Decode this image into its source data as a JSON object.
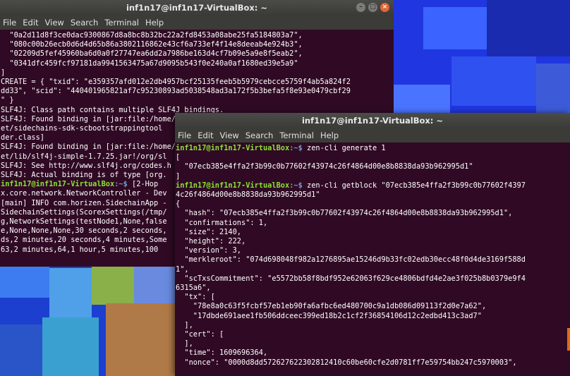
{
  "menu": [
    "File",
    "Edit",
    "View",
    "Search",
    "Terminal",
    "Help"
  ],
  "back_terminal": {
    "title": "inf1n17@inf1n17-VirtualBox: ~",
    "lines": [
      {
        "t": "  \"0a2d11d8f3ce0dac9300867d8a8bc8b32bc22a2fd8453a08abe25fa5184803a7\","
      },
      {
        "t": "  \"080c00b26ecb0d6d4d65b86a3802116862e43cf6a733ef4f14e8deeab4e924b3\","
      },
      {
        "t": "  \"02209d5fef45960ba6d0a0f27747ea6dd2a7986be163d4cf7b09e5a9e8f5eab2\","
      },
      {
        "t": "  \"0341dfc459fcf97181da9941563475a67d9095b543f0e240a0af1680ed39e5a9\""
      },
      {
        "t": "]"
      },
      {
        "t": "CREATE = { \"txid\": \"e359357afd012e2db4957bcf25135feeb5b5979cebcce5759f4ab5a824f2"
      },
      {
        "t": "dd33\", \"scid\": \"440401965821af7c95230893ad5038548ad3a172f5b3befa5f8e93e0479cbf29"
      },
      {
        "t": "\" }"
      },
      {
        "t": "SLF4J: Class path contains multiple SLF4J bindings."
      },
      {
        "t": "SLF4J: Found binding in [jar:file:/home/"
      },
      {
        "t": "et/sidechains-sdk-scbootstrappingtool"
      },
      {
        "t": "der.class]"
      },
      {
        "t": "SLF4J: Found binding in [jar:file:/home/"
      },
      {
        "t": "et/lib/slf4j-simple-1.7.25.jar!/org/sl"
      },
      {
        "t": "SLF4J: See http://www.slf4j.org/codes.h"
      },
      {
        "t": "SLF4J: Actual binding is of type [org."
      },
      {
        "u": "inf1n17@inf1n17-VirtualBox",
        "p": ":~$",
        "t": " [2-Hop"
      },
      {
        "t": "x.core.network.NetworkController - Dev"
      },
      {
        "t": "[main] INFO com.horizen.SidechainApp -"
      },
      {
        "t": "SidechainSettings(ScorexSettings(/tmp/"
      },
      {
        "t": "g,NetworkSettings(testNode1,None,false"
      },
      {
        "t": "e,None,None,None,30 seconds,2 seconds,"
      },
      {
        "t": "ds,2 minutes,20 seconds,4 minutes,Some"
      },
      {
        "t": "63,2 minutes,64,1 hour,5 minutes,100"
      }
    ]
  },
  "front_terminal": {
    "title": "inf1n17@inf1n17-VirtualBox: ~",
    "lines": [
      {
        "u": "inf1n17@inf1n17-VirtualBox",
        "p": ":~$",
        "t": " zen-cli generate 1"
      },
      {
        "t": "["
      },
      {
        "t": "  \"07ecb385e4ffa2f3b99c0b77602f43974c26f4864d00e8b8838da93b962995d1\""
      },
      {
        "t": "]"
      },
      {
        "u": "inf1n17@inf1n17-VirtualBox",
        "p": ":~$",
        "t": " zen-cli getblock \"07ecb385e4ffa2f3b99c0b77602f4397"
      },
      {
        "t": "4c26f4864d00e8b8838da93b962995d1\""
      },
      {
        "t": "{"
      },
      {
        "t": "  \"hash\": \"07ecb385e4ffa2f3b99c0b77602f43974c26f4864d00e8b8838da93b962995d1\","
      },
      {
        "t": "  \"confirmations\": 1,"
      },
      {
        "t": "  \"size\": 2140,"
      },
      {
        "t": "  \"height\": 222,"
      },
      {
        "t": "  \"version\": 3,"
      },
      {
        "t": "  \"merkleroot\": \"074d698048f982a1276895ae15246d9b33fc02edb30ecc48f0d4de3169f588d"
      },
      {
        "t": "1\","
      },
      {
        "t": "  \"scTxsCommitment\": \"e5572bb58f8bdf952e62063f629ce4806bdfd4e2ae3f025b8b0379e9f4"
      },
      {
        "t": "6315a6\","
      },
      {
        "t": "  \"tx\": ["
      },
      {
        "t": "    \"78e8a0c63f5fcbf57eb1eb90fa6afbc6ed480700c9a1db086d09113f2d0e7a62\","
      },
      {
        "t": "    \"17dbde691aee1fb506ddceec399ed18b2c1cf2f36854106d12c2edbd413c3ad7\""
      },
      {
        "t": "  ],"
      },
      {
        "t": "  \"cert\": ["
      },
      {
        "t": "  ],"
      },
      {
        "t": "  \"time\": 1609696364,"
      },
      {
        "t": "  \"nonce\": \"0000d8dd572627622302812410c60be60cfe2d0781ff7e59754bb247c5970003\","
      }
    ]
  }
}
